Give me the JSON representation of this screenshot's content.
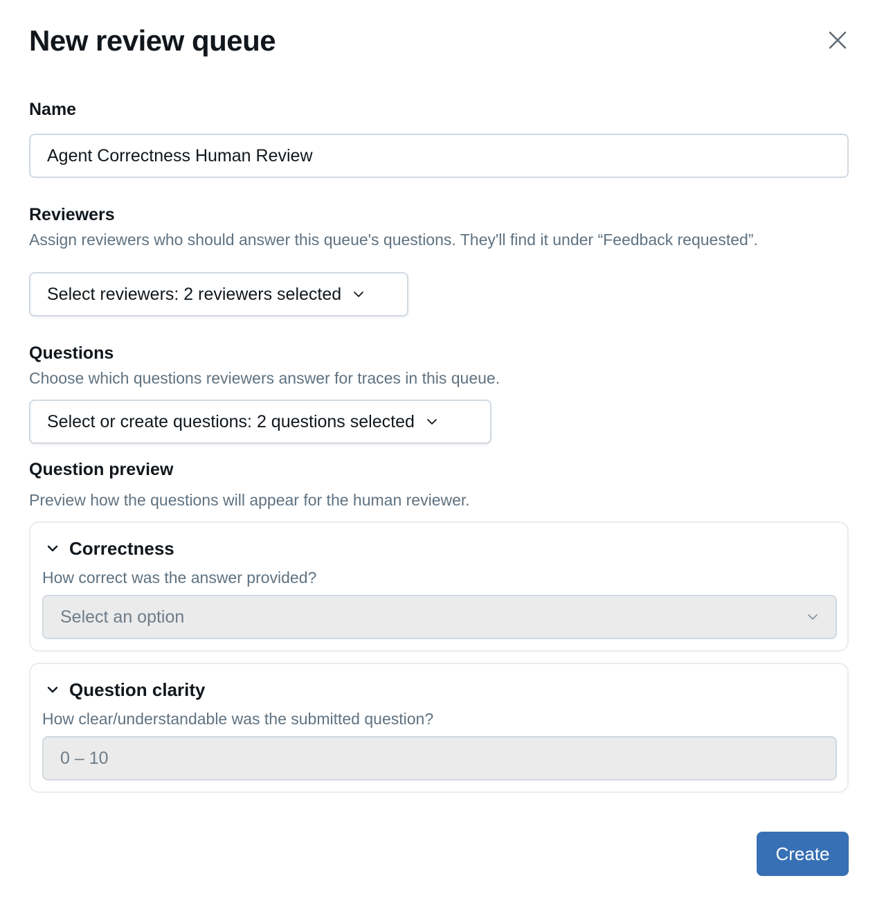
{
  "dialog": {
    "title": "New review queue",
    "close_icon": "close-icon"
  },
  "name_field": {
    "label": "Name",
    "value": "Agent Correctness Human Review"
  },
  "reviewers": {
    "label": "Reviewers",
    "description": "Assign reviewers who should answer this queue's questions. They'll find it under “Feedback requested”.",
    "select_label": "Select reviewers: 2 reviewers selected",
    "icon": "chevron-down-icon"
  },
  "questions": {
    "label": "Questions",
    "description": "Choose which questions reviewers answer for traces in this queue.",
    "select_label": "Select or create questions: 2 questions selected",
    "icon": "chevron-down-icon"
  },
  "preview": {
    "label": "Question preview",
    "description": "Preview how the questions will appear for the human reviewer.",
    "cards": [
      {
        "title": "Correctness",
        "question": "How correct was the answer provided?",
        "placeholder": "Select an option",
        "expanded": true
      },
      {
        "title": "Question clarity",
        "question": "How clear/understandable was the submitted question?",
        "placeholder": "0 – 10",
        "expanded": true
      }
    ]
  },
  "footer": {
    "create_label": "Create",
    "create_color": "#3870b5"
  }
}
